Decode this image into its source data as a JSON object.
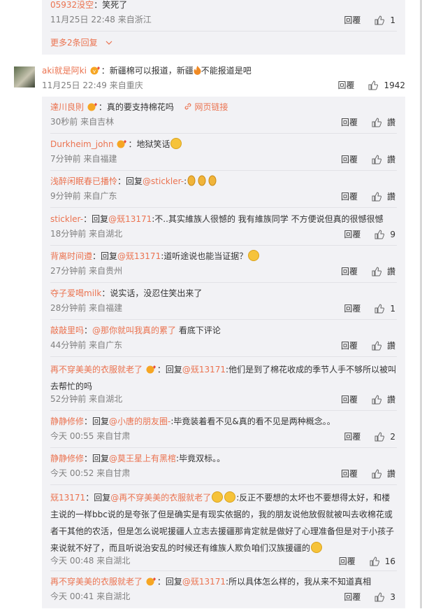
{
  "top_thread": {
    "last_reply": {
      "user": "05932没空",
      "text": "：笑死了",
      "time": "11月25日 22:48 来自浙江",
      "reply_label": "回覆",
      "likes": "1"
    },
    "more_replies_label": "更多2条回复",
    "more_icon": "chevron-down-icon"
  },
  "main_comment": {
    "user": "aki就是阿ki",
    "text_part1": "：新疆棉可以报道，新疆",
    "text_part2": "不能报道是吧",
    "time": "11月25日 22:49 来自重庆",
    "reply_label": "回覆",
    "likes": "1942"
  },
  "replies": [
    {
      "user": "達川良則",
      "text": "：真的要支持棉花吗",
      "link": "网页链接",
      "time": "30秒前 来自吉林",
      "reply_label": "回覆",
      "likes": "讚"
    },
    {
      "user": "Durkheim_john",
      "text": "：地狱笑话",
      "time": "7分钟前 来自福建",
      "reply_label": "回覆",
      "likes": "讚"
    },
    {
      "user": "浅醉闲眠春已播怜",
      "prefix": "：回复",
      "mention": "@stickler-",
      "text": ":",
      "time": "9分钟前 来自广东",
      "reply_label": "回覆",
      "likes": "讚"
    },
    {
      "user": "stickler-",
      "prefix": "：回复",
      "mention": "@兓13171",
      "text": ":不..其实維族人很憾的 我有維族同学 不方便说但真的很憾很憾",
      "time": "18分钟前 来自湖北",
      "reply_label": "回覆",
      "likes": "9"
    },
    {
      "user": "背离时间遵",
      "prefix": "：回复",
      "mention": "@兓13171",
      "text": ":道听途说也能当证据？",
      "time": "27分钟前 来自贵州",
      "reply_label": "回覆",
      "likes": "讚"
    },
    {
      "user": "夺子爱喝milk",
      "text": "：说实话，没忍住笑出来了",
      "time": "28分钟前 来自福建",
      "reply_label": "回覆",
      "likes": "1"
    },
    {
      "user": "敲敲里吗",
      "prefix": "：",
      "mention": "@那你就叫我真的累了",
      "text": " 看底下评论",
      "time": "44分钟前 来自广东",
      "reply_label": "回覆",
      "likes": "讚"
    },
    {
      "user": "再不穿美美的衣服就老了",
      "prefix": "：回复",
      "mention": "@兓13171",
      "text": ":他们是到了棉花收成的季节人手不够所以被叫去帮忙的吗",
      "time": "52分钟前 来自湖北",
      "reply_label": "回覆",
      "likes": "讚"
    },
    {
      "user": "静静修修",
      "prefix": "：回复",
      "mention": "@小唐的朋友圈-",
      "text": ":毕竟装着看不见&真的看不见是两种概念。。",
      "time": "今天 00:55 来自甘肃",
      "reply_label": "回覆",
      "likes": "2"
    },
    {
      "user": "静静修修",
      "prefix": "：回复",
      "mention": "@莫王星上有黑棺",
      "text": ":毕竟双标。。",
      "time": "今天 00:52 来自甘肃",
      "reply_label": "回覆",
      "likes": "讚"
    },
    {
      "user": "兓13171",
      "prefix": "：回复",
      "mention": "@再不穿美美的衣服就老了",
      "text": ":反正不要想的太坏也不要想得太好，和楼主说的一样bbc说的是夸张了但是确实是有现实依据的，我的朋友说他放假就被叫去收棉花或者干其他的农活，但是怎么说呢援疆人立志去援疆那肯定就是做好了心理准备但是对于小孩子来说就不好了，而且听说治安乱的时候还有维族人欺负咱们汉族援疆的",
      "time": "今天 00:48 来自湖北",
      "reply_label": "回覆",
      "likes": "16"
    },
    {
      "user": "再不穿美美的衣服就老了",
      "prefix": "：回复",
      "mention": "@兓13171",
      "text": ":所以具体怎么样的，我从来不知道真相",
      "time": "今天 00:41 来自湖北",
      "reply_label": "回覆",
      "likes": "3"
    }
  ],
  "colors": {
    "link": "#eb7350",
    "meta": "#808080",
    "sub_bg": "#f2f2f5"
  }
}
